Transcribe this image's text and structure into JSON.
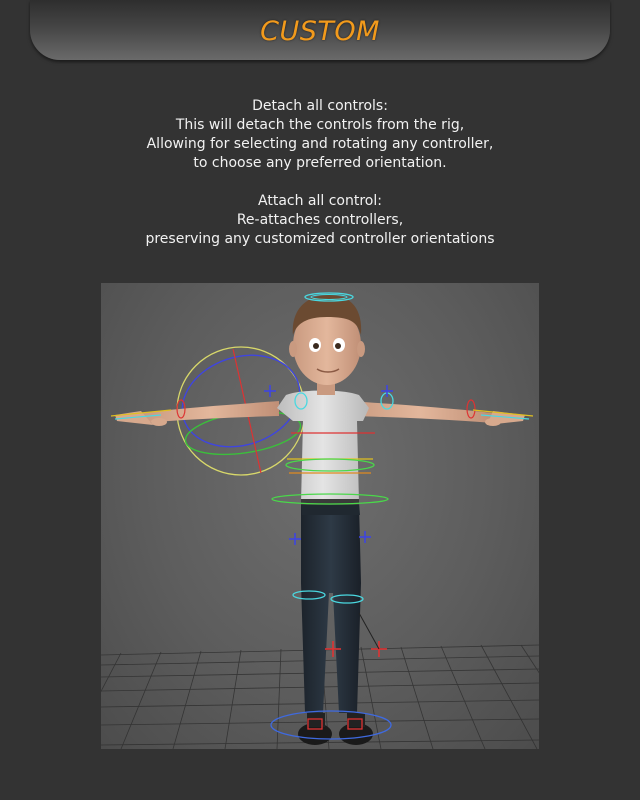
{
  "header": {
    "title": "CUSTOM"
  },
  "description": {
    "detach_heading": "Detach all controls:",
    "detach_lines": [
      "This will detach the controls from the rig,",
      "Allowing for selecting and rotating any controller,",
      "to choose any preferred orientation."
    ],
    "attach_heading": "Attach all control:",
    "attach_lines": [
      "Re-attaches controllers,",
      "preserving any customized controller orientations"
    ]
  },
  "colors": {
    "title_orange": "#f29a1c",
    "background": "#333333",
    "text": "#f2f2f2"
  },
  "viewport": {
    "content": "rigged cartoon character in T-pose with controller curves over a perspective grid"
  }
}
